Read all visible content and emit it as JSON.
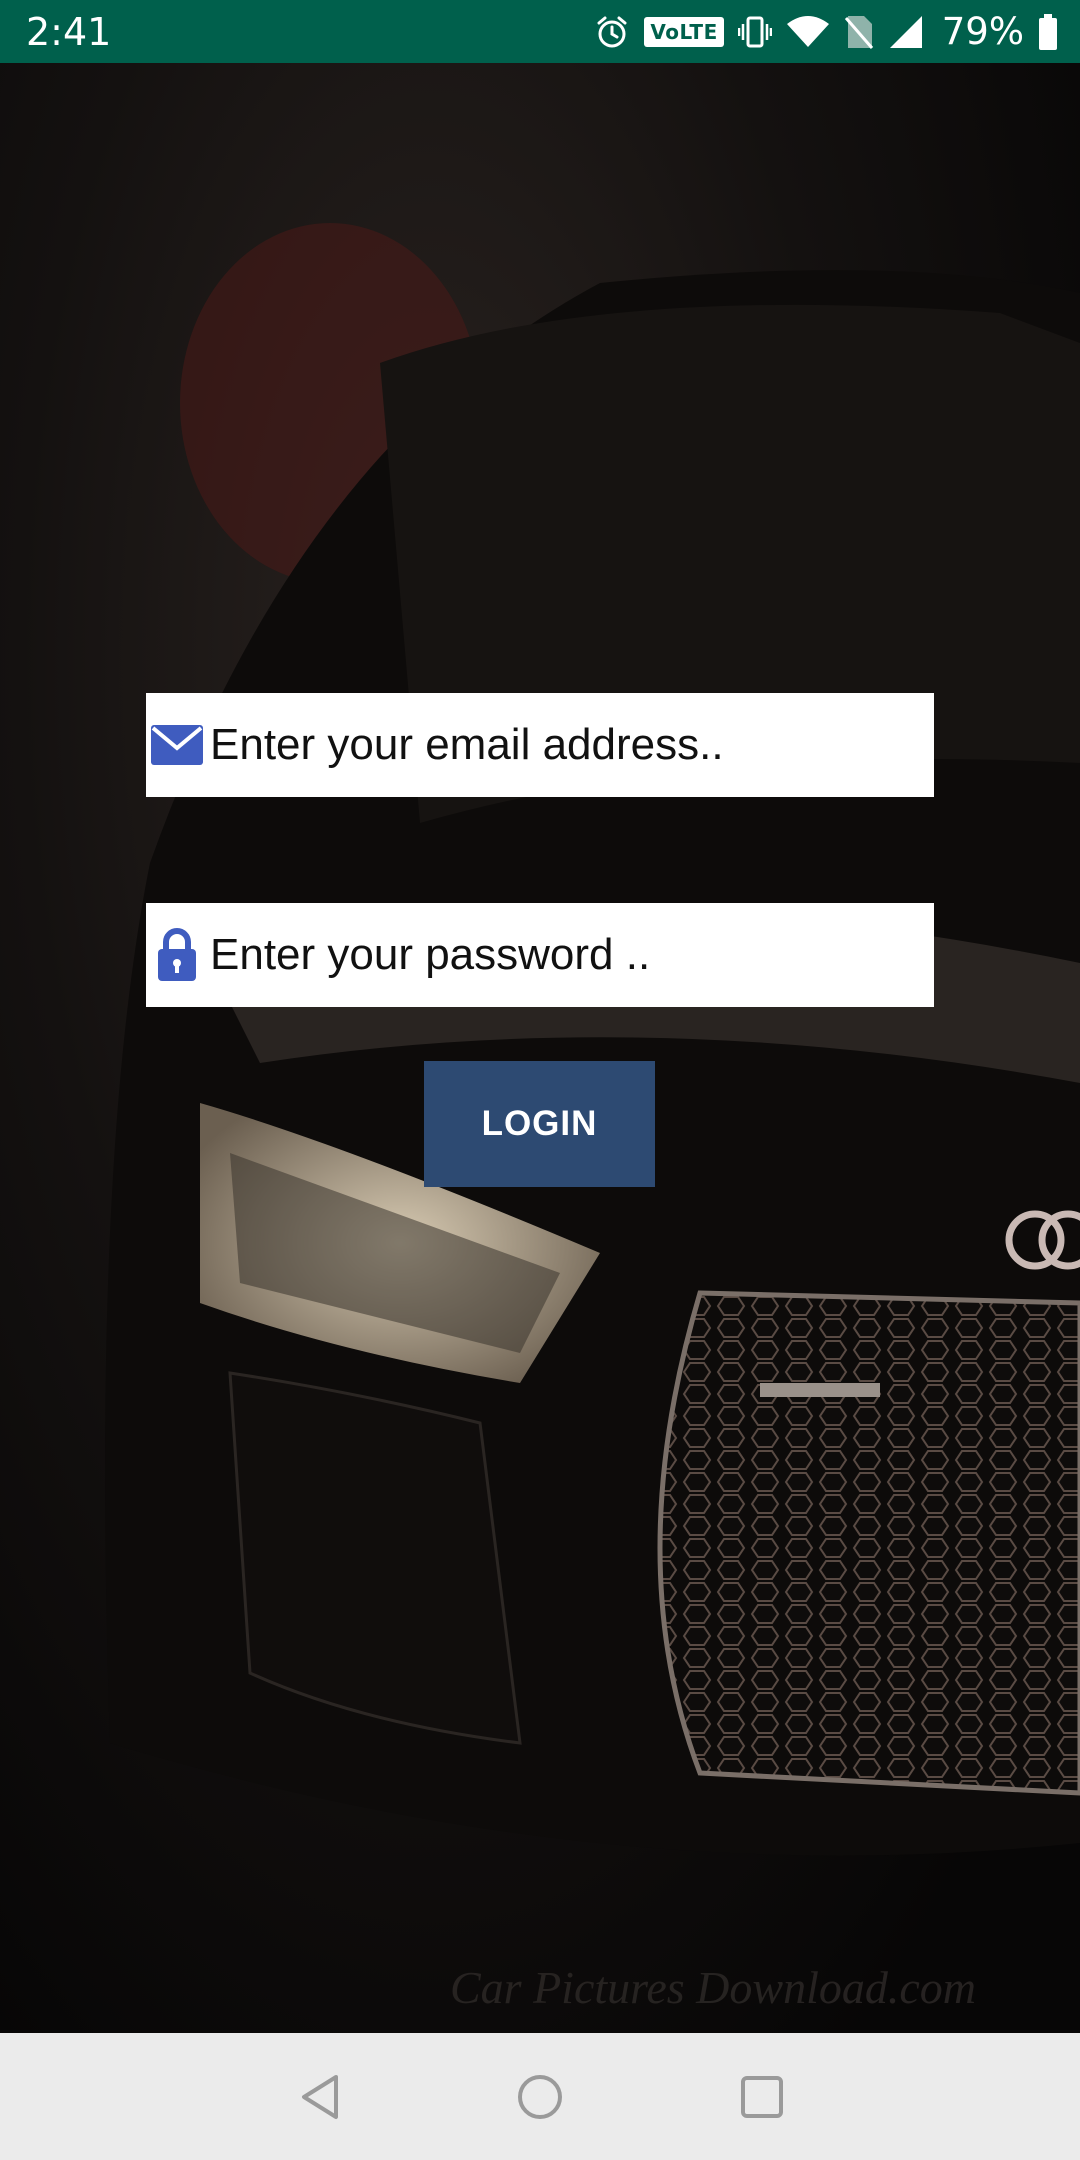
{
  "status_bar": {
    "time": "2:41",
    "volte_label": "VoLTE",
    "battery_percent": "79%",
    "icons": [
      "alarm-icon",
      "volte-icon",
      "vibrate-icon",
      "wifi-icon",
      "no-sim-icon",
      "signal-icon",
      "battery-icon"
    ]
  },
  "background": {
    "description_icon": "car-photo",
    "watermark": "Car Pictures Download.com"
  },
  "login_form": {
    "email": {
      "icon": "mail-icon",
      "placeholder": "Enter your email address..",
      "value": ""
    },
    "password": {
      "icon": "lock-icon",
      "placeholder": "Enter your password ..",
      "value": ""
    },
    "login_label": "LOGIN"
  },
  "nav_bar": {
    "icons": [
      "back-icon",
      "home-icon",
      "recents-icon"
    ]
  },
  "colors": {
    "status_bar": "#00604c",
    "button": "#2d4a72",
    "icon_blue": "#3f5cbf",
    "nav_bar": "#ebebeb"
  }
}
